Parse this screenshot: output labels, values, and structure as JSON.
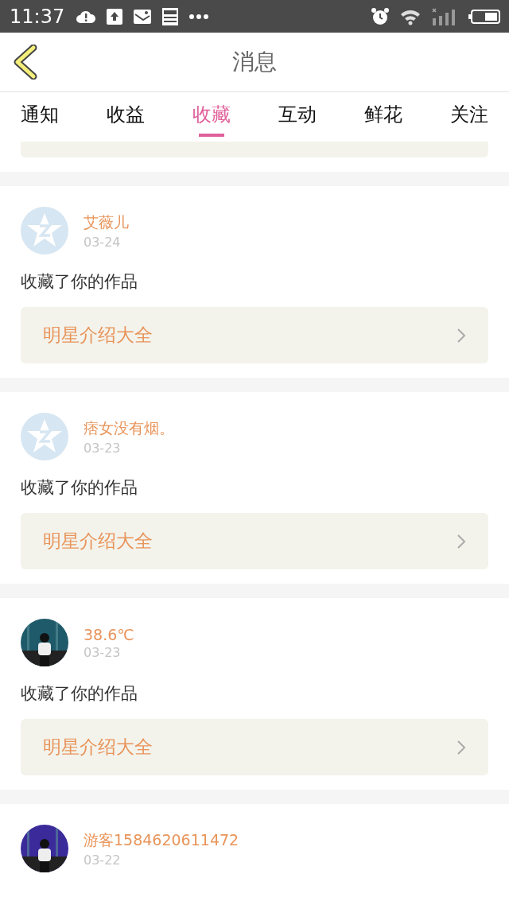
{
  "status_bar": {
    "time": "11:37"
  },
  "header": {
    "title": "消息"
  },
  "tabs": [
    {
      "label": "通知",
      "selected": false
    },
    {
      "label": "收益",
      "selected": false
    },
    {
      "label": "收藏",
      "selected": true
    },
    {
      "label": "互动",
      "selected": false
    },
    {
      "label": "鲜花",
      "selected": false
    },
    {
      "label": "关注",
      "selected": false
    }
  ],
  "messages": [
    {
      "avatar": {
        "kind": "default"
      },
      "name": "艾薇儿",
      "date": "03-24",
      "text": "收藏了你的作品",
      "work": "明星介绍大全"
    },
    {
      "avatar": {
        "kind": "default"
      },
      "name": "痞女没有烟。",
      "date": "03-23",
      "text": "收藏了你的作品",
      "work": "明星介绍大全"
    },
    {
      "name": "38.6℃",
      "date": "03-23",
      "text": "收藏了你的作品",
      "work": "明星介绍大全"
    },
    {
      "name": "游客1584620611472",
      "date": "03-22"
    }
  ]
}
